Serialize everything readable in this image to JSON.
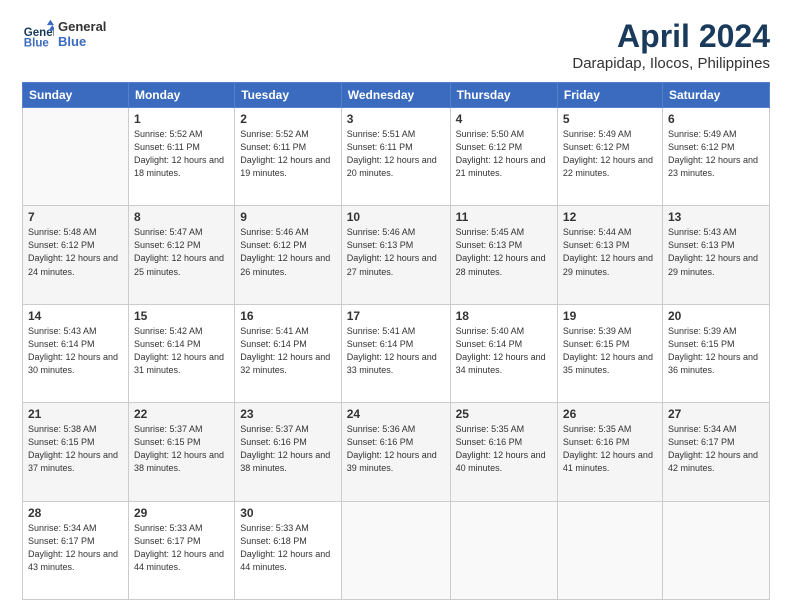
{
  "logo": {
    "line1": "General",
    "line2": "Blue"
  },
  "title": "April 2024",
  "location": "Darapidap, Ilocos, Philippines",
  "headers": [
    "Sunday",
    "Monday",
    "Tuesday",
    "Wednesday",
    "Thursday",
    "Friday",
    "Saturday"
  ],
  "rows": [
    [
      {
        "day": "",
        "sunrise": "",
        "sunset": "",
        "daylight": ""
      },
      {
        "day": "1",
        "sunrise": "Sunrise: 5:52 AM",
        "sunset": "Sunset: 6:11 PM",
        "daylight": "Daylight: 12 hours and 18 minutes."
      },
      {
        "day": "2",
        "sunrise": "Sunrise: 5:52 AM",
        "sunset": "Sunset: 6:11 PM",
        "daylight": "Daylight: 12 hours and 19 minutes."
      },
      {
        "day": "3",
        "sunrise": "Sunrise: 5:51 AM",
        "sunset": "Sunset: 6:11 PM",
        "daylight": "Daylight: 12 hours and 20 minutes."
      },
      {
        "day": "4",
        "sunrise": "Sunrise: 5:50 AM",
        "sunset": "Sunset: 6:12 PM",
        "daylight": "Daylight: 12 hours and 21 minutes."
      },
      {
        "day": "5",
        "sunrise": "Sunrise: 5:49 AM",
        "sunset": "Sunset: 6:12 PM",
        "daylight": "Daylight: 12 hours and 22 minutes."
      },
      {
        "day": "6",
        "sunrise": "Sunrise: 5:49 AM",
        "sunset": "Sunset: 6:12 PM",
        "daylight": "Daylight: 12 hours and 23 minutes."
      }
    ],
    [
      {
        "day": "7",
        "sunrise": "Sunrise: 5:48 AM",
        "sunset": "Sunset: 6:12 PM",
        "daylight": "Daylight: 12 hours and 24 minutes."
      },
      {
        "day": "8",
        "sunrise": "Sunrise: 5:47 AM",
        "sunset": "Sunset: 6:12 PM",
        "daylight": "Daylight: 12 hours and 25 minutes."
      },
      {
        "day": "9",
        "sunrise": "Sunrise: 5:46 AM",
        "sunset": "Sunset: 6:12 PM",
        "daylight": "Daylight: 12 hours and 26 minutes."
      },
      {
        "day": "10",
        "sunrise": "Sunrise: 5:46 AM",
        "sunset": "Sunset: 6:13 PM",
        "daylight": "Daylight: 12 hours and 27 minutes."
      },
      {
        "day": "11",
        "sunrise": "Sunrise: 5:45 AM",
        "sunset": "Sunset: 6:13 PM",
        "daylight": "Daylight: 12 hours and 28 minutes."
      },
      {
        "day": "12",
        "sunrise": "Sunrise: 5:44 AM",
        "sunset": "Sunset: 6:13 PM",
        "daylight": "Daylight: 12 hours and 29 minutes."
      },
      {
        "day": "13",
        "sunrise": "Sunrise: 5:43 AM",
        "sunset": "Sunset: 6:13 PM",
        "daylight": "Daylight: 12 hours and 29 minutes."
      }
    ],
    [
      {
        "day": "14",
        "sunrise": "Sunrise: 5:43 AM",
        "sunset": "Sunset: 6:14 PM",
        "daylight": "Daylight: 12 hours and 30 minutes."
      },
      {
        "day": "15",
        "sunrise": "Sunrise: 5:42 AM",
        "sunset": "Sunset: 6:14 PM",
        "daylight": "Daylight: 12 hours and 31 minutes."
      },
      {
        "day": "16",
        "sunrise": "Sunrise: 5:41 AM",
        "sunset": "Sunset: 6:14 PM",
        "daylight": "Daylight: 12 hours and 32 minutes."
      },
      {
        "day": "17",
        "sunrise": "Sunrise: 5:41 AM",
        "sunset": "Sunset: 6:14 PM",
        "daylight": "Daylight: 12 hours and 33 minutes."
      },
      {
        "day": "18",
        "sunrise": "Sunrise: 5:40 AM",
        "sunset": "Sunset: 6:14 PM",
        "daylight": "Daylight: 12 hours and 34 minutes."
      },
      {
        "day": "19",
        "sunrise": "Sunrise: 5:39 AM",
        "sunset": "Sunset: 6:15 PM",
        "daylight": "Daylight: 12 hours and 35 minutes."
      },
      {
        "day": "20",
        "sunrise": "Sunrise: 5:39 AM",
        "sunset": "Sunset: 6:15 PM",
        "daylight": "Daylight: 12 hours and 36 minutes."
      }
    ],
    [
      {
        "day": "21",
        "sunrise": "Sunrise: 5:38 AM",
        "sunset": "Sunset: 6:15 PM",
        "daylight": "Daylight: 12 hours and 37 minutes."
      },
      {
        "day": "22",
        "sunrise": "Sunrise: 5:37 AM",
        "sunset": "Sunset: 6:15 PM",
        "daylight": "Daylight: 12 hours and 38 minutes."
      },
      {
        "day": "23",
        "sunrise": "Sunrise: 5:37 AM",
        "sunset": "Sunset: 6:16 PM",
        "daylight": "Daylight: 12 hours and 38 minutes."
      },
      {
        "day": "24",
        "sunrise": "Sunrise: 5:36 AM",
        "sunset": "Sunset: 6:16 PM",
        "daylight": "Daylight: 12 hours and 39 minutes."
      },
      {
        "day": "25",
        "sunrise": "Sunrise: 5:35 AM",
        "sunset": "Sunset: 6:16 PM",
        "daylight": "Daylight: 12 hours and 40 minutes."
      },
      {
        "day": "26",
        "sunrise": "Sunrise: 5:35 AM",
        "sunset": "Sunset: 6:16 PM",
        "daylight": "Daylight: 12 hours and 41 minutes."
      },
      {
        "day": "27",
        "sunrise": "Sunrise: 5:34 AM",
        "sunset": "Sunset: 6:17 PM",
        "daylight": "Daylight: 12 hours and 42 minutes."
      }
    ],
    [
      {
        "day": "28",
        "sunrise": "Sunrise: 5:34 AM",
        "sunset": "Sunset: 6:17 PM",
        "daylight": "Daylight: 12 hours and 43 minutes."
      },
      {
        "day": "29",
        "sunrise": "Sunrise: 5:33 AM",
        "sunset": "Sunset: 6:17 PM",
        "daylight": "Daylight: 12 hours and 44 minutes."
      },
      {
        "day": "30",
        "sunrise": "Sunrise: 5:33 AM",
        "sunset": "Sunset: 6:18 PM",
        "daylight": "Daylight: 12 hours and 44 minutes."
      },
      {
        "day": "",
        "sunrise": "",
        "sunset": "",
        "daylight": ""
      },
      {
        "day": "",
        "sunrise": "",
        "sunset": "",
        "daylight": ""
      },
      {
        "day": "",
        "sunrise": "",
        "sunset": "",
        "daylight": ""
      },
      {
        "day": "",
        "sunrise": "",
        "sunset": "",
        "daylight": ""
      }
    ]
  ]
}
